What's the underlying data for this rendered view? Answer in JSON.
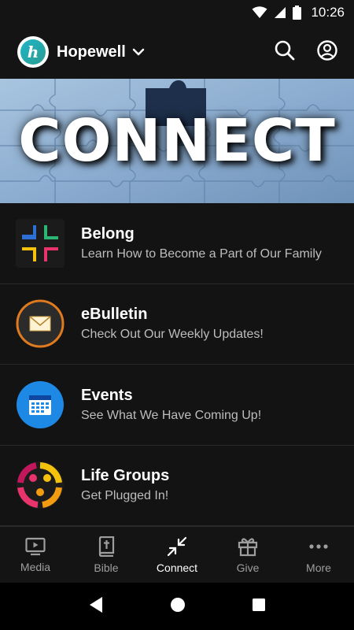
{
  "status_bar": {
    "time": "10:26"
  },
  "header": {
    "church_name": "Hopewell",
    "logo_letter": "h"
  },
  "banner": {
    "title": "CONNECT"
  },
  "items": [
    {
      "title": "Belong",
      "subtitle": "Learn How to Become a Part of Our Family",
      "icon": "belong-grid-icon"
    },
    {
      "title": "eBulletin",
      "subtitle": "Check Out Our Weekly Updates!",
      "icon": "envelope-icon"
    },
    {
      "title": "Events",
      "subtitle": "See What We Have Coming Up!",
      "icon": "calendar-icon"
    },
    {
      "title": "Life Groups",
      "subtitle": "Get Plugged In!",
      "icon": "people-circle-icon"
    }
  ],
  "bottom_nav": [
    {
      "label": "Media",
      "icon": "tv-icon",
      "active": false
    },
    {
      "label": "Bible",
      "icon": "bible-icon",
      "active": false
    },
    {
      "label": "Connect",
      "icon": "connect-arrows-icon",
      "active": true
    },
    {
      "label": "Give",
      "icon": "gift-icon",
      "active": false
    },
    {
      "label": "More",
      "icon": "more-dots-icon",
      "active": false
    }
  ],
  "colors": {
    "background": "#131313",
    "accent_orange": "#e07a1f",
    "events_blue": "#1e88e5",
    "banner_blue": "#8fb1d3"
  }
}
